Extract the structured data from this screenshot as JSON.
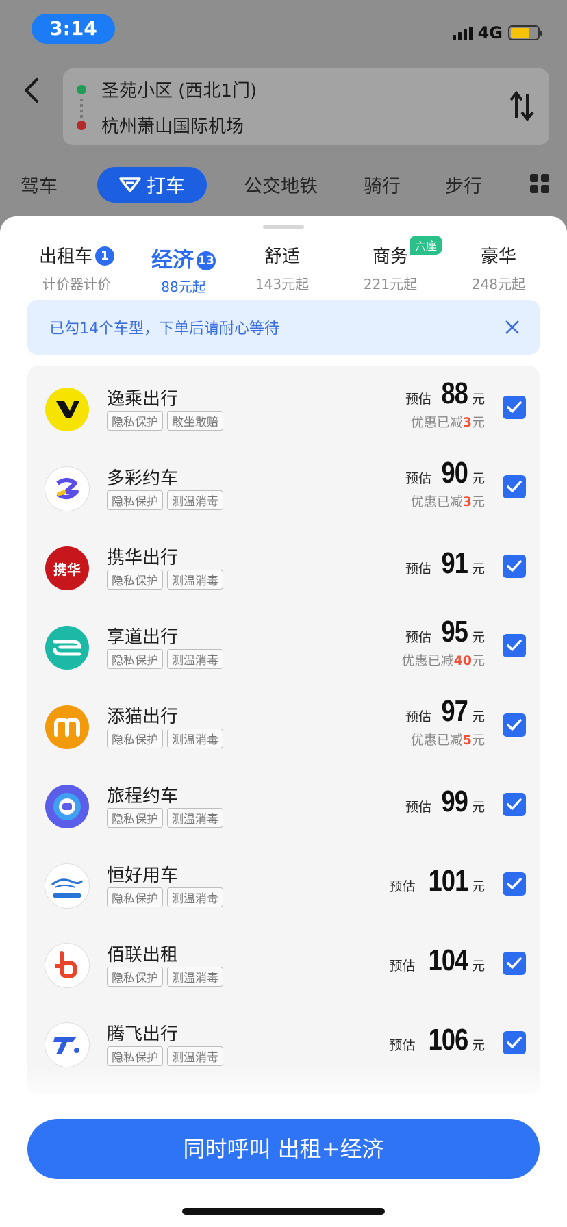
{
  "status": {
    "time": "3:14",
    "network": "4G"
  },
  "route": {
    "origin": "圣苑小区 (西北1门)",
    "destination": "杭州萧山国际机场"
  },
  "modes": {
    "drive": "驾车",
    "taxi": "打车",
    "transit": "公交地铁",
    "cycle": "骑行",
    "walk": "步行"
  },
  "categories": [
    {
      "name": "出租车",
      "badge": "1",
      "sub": "计价器计价"
    },
    {
      "name": "经济",
      "badge": "13",
      "sub": "88元起"
    },
    {
      "name": "舒适",
      "sub": "143元起"
    },
    {
      "name": "商务",
      "tag": "六座",
      "sub": "221元起"
    },
    {
      "name": "豪华",
      "sub": "248元起"
    }
  ],
  "notice": "已勾14个车型，下单后请耐心等待",
  "price_prefix": "预估",
  "price_unit": "元",
  "discount_prefix": "优惠已减",
  "providers": [
    {
      "name": "逸乘出行",
      "tags": [
        "隐私保护",
        "敢坐敢赔"
      ],
      "price": "88",
      "discount": "3",
      "logo": "yicheng-logo",
      "logo_color": "#f7e300"
    },
    {
      "name": "多彩约车",
      "tags": [
        "隐私保护",
        "测温消毒"
      ],
      "price": "90",
      "discount": "3",
      "logo": "duocai-logo",
      "logo_color": "#ffffff"
    },
    {
      "name": "携华出行",
      "tags": [
        "隐私保护",
        "测温消毒"
      ],
      "price": "91",
      "logo": "xiehua-logo",
      "logo_color": "#c8161d",
      "logo_text": "携华"
    },
    {
      "name": "享道出行",
      "tags": [
        "隐私保护",
        "测温消毒"
      ],
      "price": "95",
      "discount": "40",
      "logo": "xiangdao-logo",
      "logo_color": "#1bb9a6"
    },
    {
      "name": "添猫出行",
      "tags": [
        "隐私保护",
        "测温消毒"
      ],
      "price": "97",
      "discount": "5",
      "logo": "tianmao-logo",
      "logo_color": "#f39a0c"
    },
    {
      "name": "旅程约车",
      "tags": [
        "隐私保护",
        "测温消毒"
      ],
      "price": "99",
      "logo": "lvcheng-logo",
      "logo_color": "#5a5ee8"
    },
    {
      "name": "恒好用车",
      "tags": [
        "隐私保护",
        "测温消毒"
      ],
      "price": "101",
      "logo": "henghao-logo",
      "logo_color": "#ffffff"
    },
    {
      "name": "佰联出租",
      "tags": [
        "隐私保护",
        "测温消毒"
      ],
      "price": "104",
      "logo": "bailian-logo",
      "logo_color": "#ffffff"
    },
    {
      "name": "腾飞出行",
      "tags": [
        "隐私保护",
        "测温消毒"
      ],
      "price": "106",
      "logo": "tengfei-logo",
      "logo_color": "#ffffff"
    }
  ],
  "call_button": "同时呼叫 出租+经济",
  "colors": {
    "accent": "#2b6cf0",
    "discount": "#f0523a",
    "tag_green": "#2ac089"
  }
}
